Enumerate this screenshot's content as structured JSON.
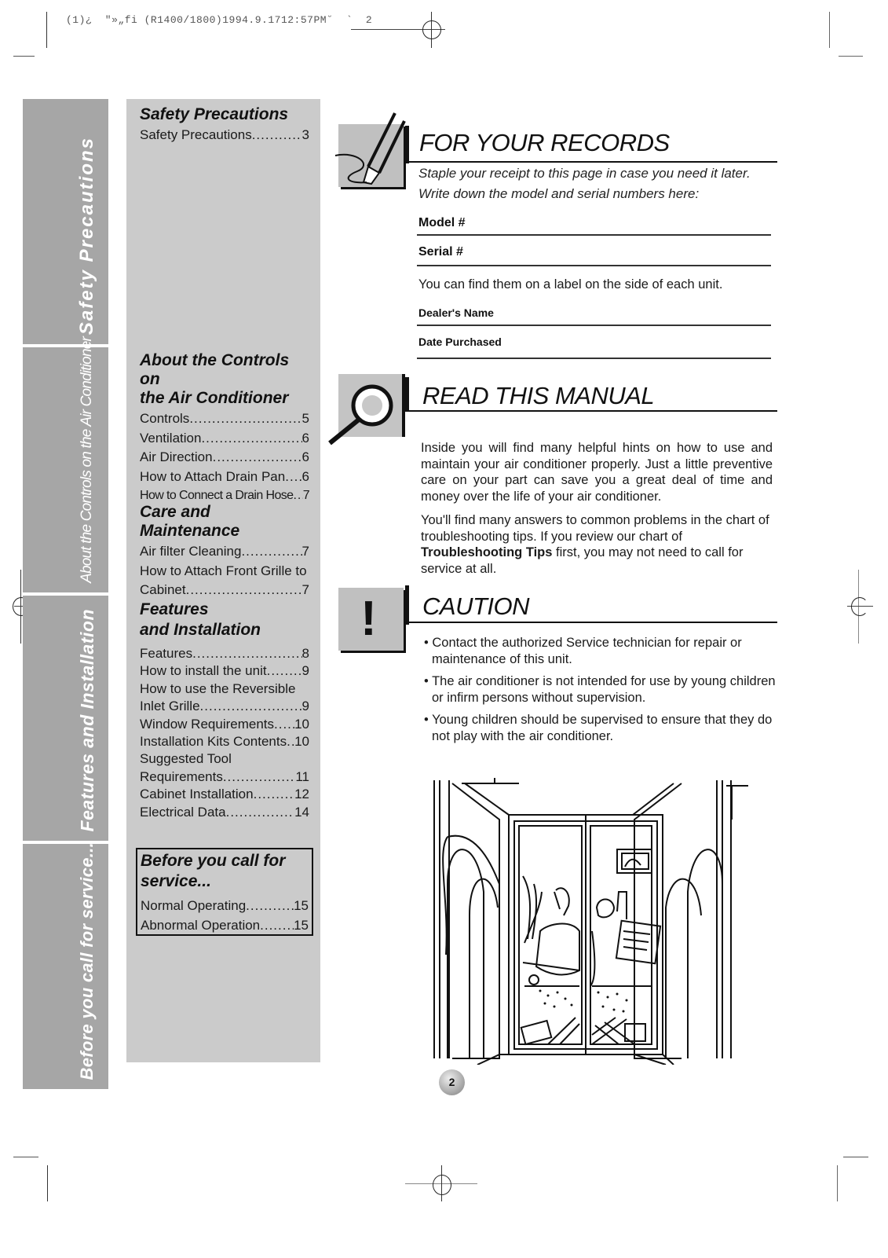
{
  "print_header": "(1)¿  \"»„fi (R1400/1800)1994.9.1712:57PM˘  `  2",
  "side_tabs": [
    {
      "label": "Safety Precautions"
    },
    {
      "label": "About the Controls on the Air Conditioner"
    },
    {
      "label": "Features and Installation"
    },
    {
      "label": "Before you call for service..."
    }
  ],
  "toc": {
    "sections": [
      {
        "heading": "Safety Precautions",
        "items": [
          {
            "title": "Safety Precautions",
            "page": "3"
          }
        ]
      },
      {
        "heading_line1": "About the Controls on",
        "heading_line2": "the Air Conditioner",
        "items": [
          {
            "title": "Controls",
            "page": "5"
          },
          {
            "title": "Ventilation",
            "page": "6"
          },
          {
            "title": "Air Direction",
            "page": "6"
          },
          {
            "title": "How to Attach Drain Pan",
            "page": "6"
          },
          {
            "title": "How to Connect a Drain Hose",
            "page": "7"
          }
        ]
      },
      {
        "heading": "Care and Maintenance",
        "items": [
          {
            "title": "Air filter Cleaning",
            "page": "7"
          },
          {
            "title_line1": "How to Attach Front Grille to",
            "title": "Cabinet",
            "page": "7"
          }
        ]
      },
      {
        "heading_line1": "Features",
        "heading_line2": "and Installation",
        "items": [
          {
            "title": "Features",
            "page": "8"
          },
          {
            "title": "How to install the unit",
            "page": "9"
          },
          {
            "title_line1": "How to use the Reversible",
            "title": "Inlet Grille",
            "page": "9"
          },
          {
            "title": "Window Requirements",
            "page": "10"
          },
          {
            "title": "Installation Kits Contents",
            "page": "10"
          },
          {
            "title_line1": "Suggested Tool",
            "title": "Requirements",
            "page": "11"
          },
          {
            "title": "Cabinet Installation",
            "page": "12"
          },
          {
            "title": "Electrical Data",
            "page": "14"
          }
        ]
      },
      {
        "heading_line1": "Before you call for",
        "heading_line2": "service...",
        "items": [
          {
            "title": "Normal Operating",
            "page": "15"
          },
          {
            "title": "Abnormal Operation",
            "page": "15"
          }
        ]
      }
    ]
  },
  "records": {
    "title": "FOR YOUR RECORDS",
    "note_line1": "Staple your receipt to this page in case you need it later.",
    "note_line2": "Write down the model and serial numbers here:",
    "model_label": "Model #",
    "serial_label": "Serial #",
    "label_hint": "You can find them on a label on the side of each unit.",
    "dealer_label": "Dealer's Name",
    "date_label": "Date Purchased"
  },
  "manual": {
    "title": "READ THIS MANUAL",
    "para1": "Inside you will find many helpful hints on how to use and maintain your air conditioner properly. Just a little preventive care on your part can save you a great deal of time and money over the life of your air conditioner.",
    "para2_before": "You'll find many answers to common problems in the chart of troubleshooting tips. If you review our chart of ",
    "para2_bold": "Troubleshooting Tips",
    "para2_after": " first, you may not need to call for service at all."
  },
  "caution": {
    "title": "CAUTION",
    "icon_glyph": "!",
    "bullets": [
      "• Contact the authorized Service technician for repair or maintenance of this unit.",
      "• The air conditioner is not intended for use by young children or infirm persons without supervision.",
      "• Young children should be supervised to ensure that they do not play with the air conditioner."
    ]
  },
  "illustration": {
    "description": "window-family-scene"
  },
  "page_number": "2",
  "colors": {
    "tab_gray": "#a6a6a6",
    "toc_gray": "#cbcbcb",
    "icon_gray": "#c0c0c0"
  }
}
